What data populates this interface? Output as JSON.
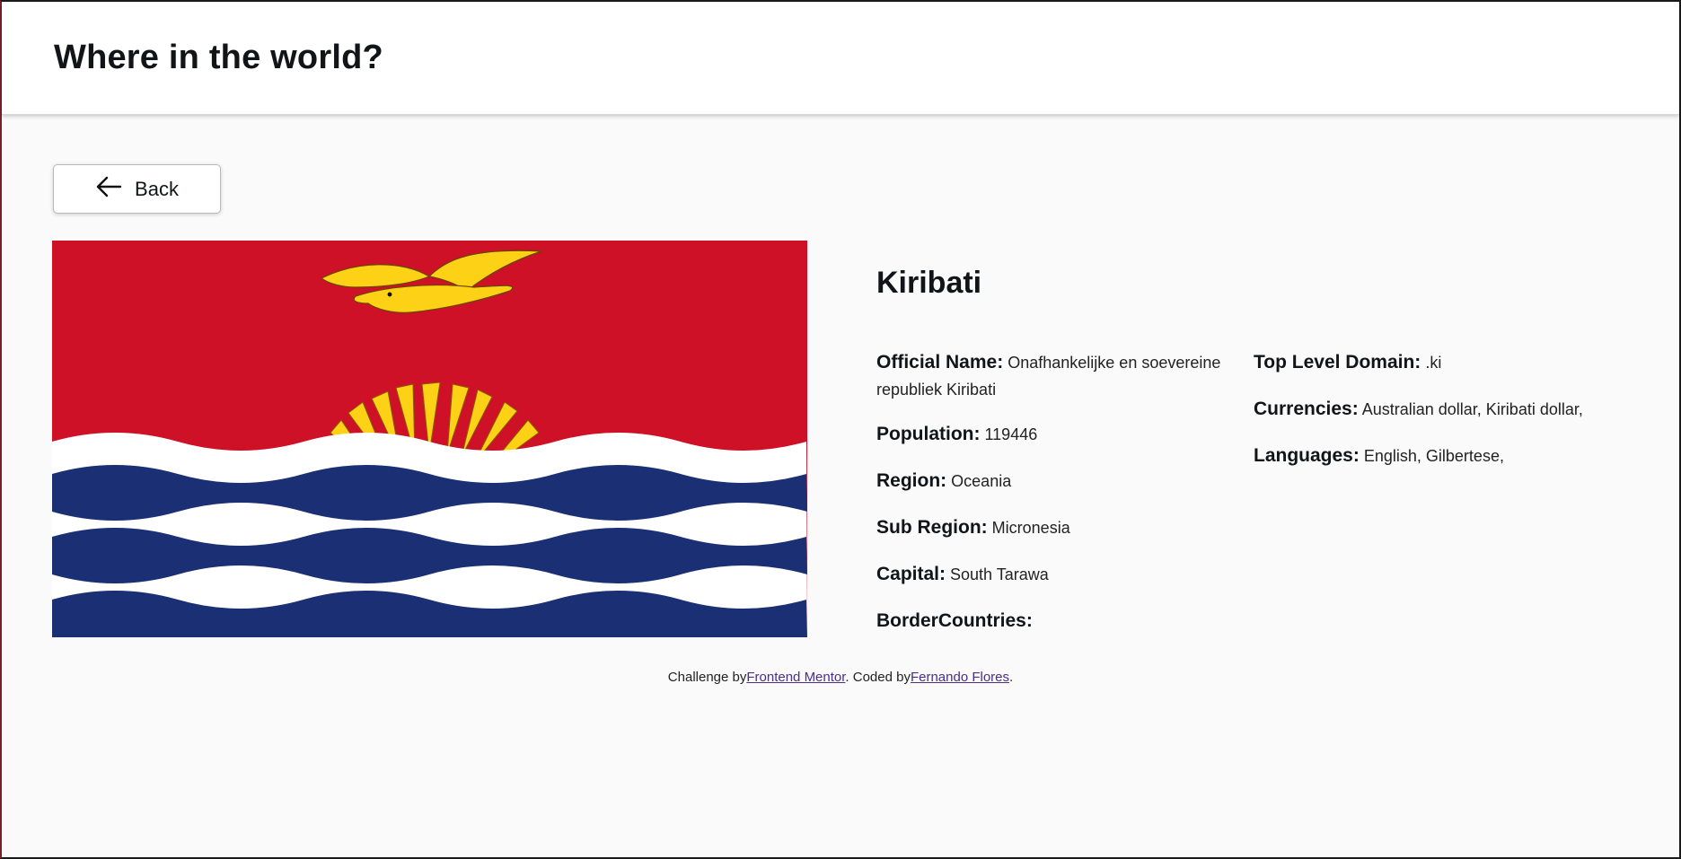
{
  "header": {
    "title": "Where in the world?"
  },
  "back_button": {
    "label": "Back",
    "icon": "arrow-left-icon"
  },
  "country": {
    "name": "Kiribati",
    "flag_icon": "kiribati-flag",
    "official_name": {
      "label": "Official Name:",
      "value": "Onafhankelijke en soevereine republiek Kiribati"
    },
    "population": {
      "label": "Population:",
      "value": "119446"
    },
    "region": {
      "label": "Region:",
      "value": "Oceania"
    },
    "sub_region": {
      "label": "Sub Region:",
      "value": "Micronesia"
    },
    "capital": {
      "label": "Capital:",
      "value": "South Tarawa"
    },
    "border_countries": {
      "label": "BorderCountries:"
    },
    "tld": {
      "label": "Top Level Domain:",
      "value": ".ki"
    },
    "currencies": {
      "label": "Currencies:",
      "value": "Australian dollar, Kiribati dollar,"
    },
    "languages": {
      "label": "Languages:",
      "value": "English, Gilbertese,"
    }
  },
  "footer": {
    "prefix": "Challenge by",
    "link1": "Frontend Mentor",
    "middle": ". Coded by",
    "link2": "Fernando Flores",
    "suffix": "."
  },
  "colors": {
    "flag_red": "#ce1126",
    "flag_blue": "#1b2f74",
    "flag_gold": "#fcd116",
    "background": "#fafafa"
  }
}
